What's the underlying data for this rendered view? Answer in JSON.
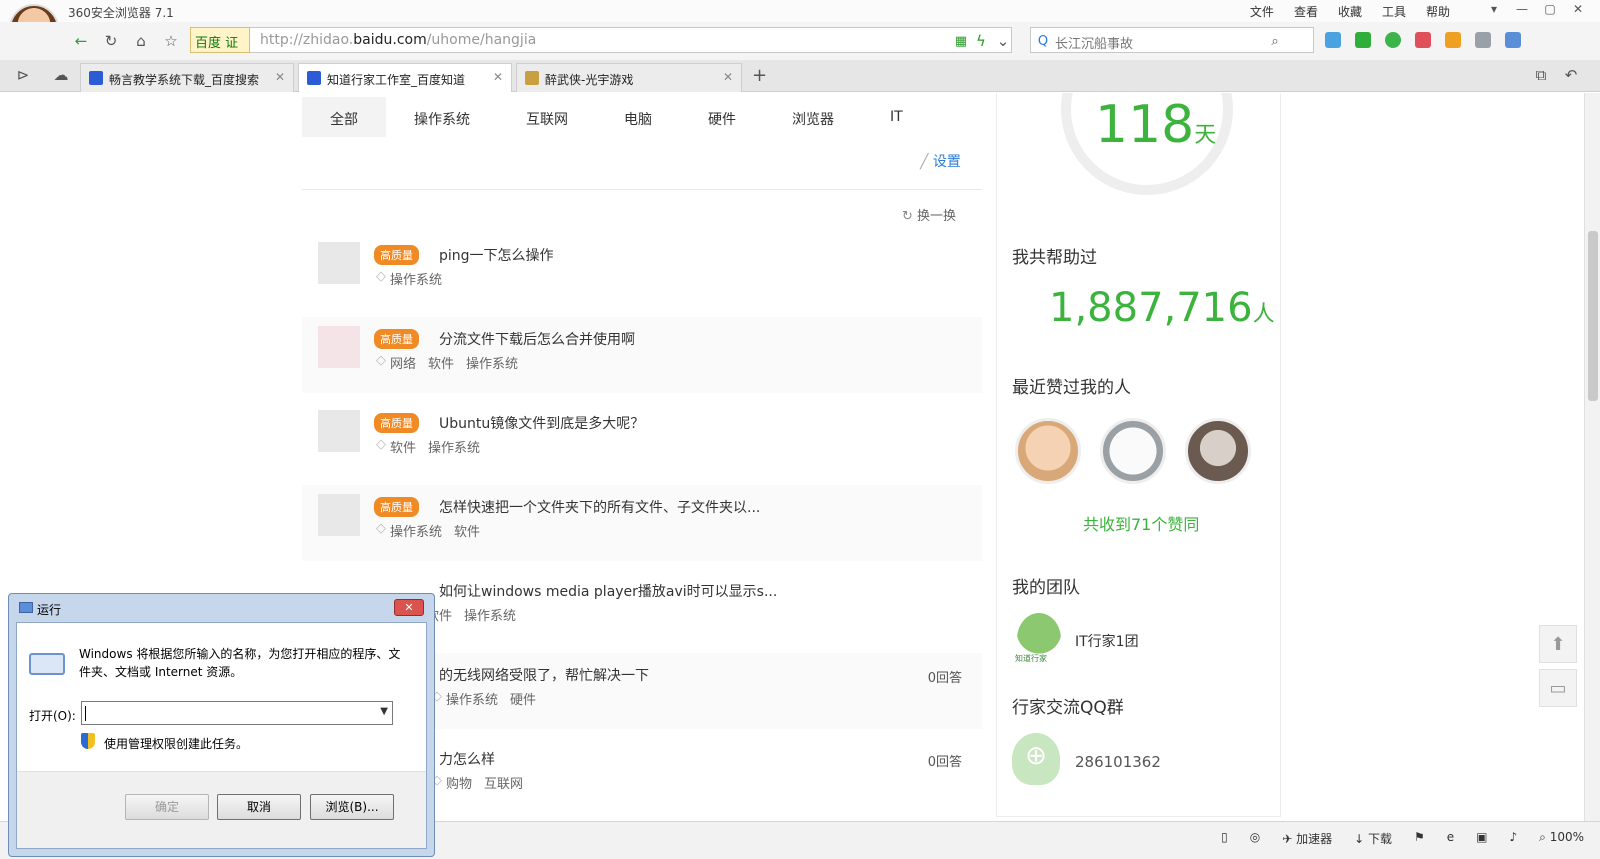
{
  "browser": {
    "app_title": "360安全浏览器 7.1",
    "menu": [
      "文件",
      "查看",
      "收藏",
      "工具",
      "帮助"
    ],
    "url_badge": "百度 证",
    "url_prefix": "http://zhidao.",
    "url_domain": "baidu.com",
    "url_path": "/uhome/hangjia",
    "search_placeholder": "长江沉船事故",
    "tabs": [
      {
        "label": "畅言教学系统下载_百度搜索"
      },
      {
        "label": "知道行家工作室_百度知道"
      },
      {
        "label": "醉武侠-光宇游戏"
      }
    ],
    "status": [
      "加速器",
      "下载",
      "100%"
    ]
  },
  "categories": [
    "全部",
    "操作系统",
    "互联网",
    "电脑",
    "硬件",
    "浏览器",
    "IT"
  ],
  "settings_label": "设置",
  "refresh_label": "换一换",
  "badge_label": "高质量",
  "questions": [
    {
      "title": "ping一下怎么操作",
      "tags": [
        "操作系统"
      ],
      "answers": ""
    },
    {
      "title": "分流文件下载后怎么合并使用啊",
      "tags": [
        "网络",
        "软件",
        "操作系统"
      ],
      "answers": ""
    },
    {
      "title": "Ubuntu镜像文件到底是多大呢？",
      "tags": [
        "软件",
        "操作系统"
      ],
      "answers": ""
    },
    {
      "title": "怎样快速把一个文件夹下的所有文件、子文件夹以...",
      "tags": [
        "操作系统",
        "软件"
      ],
      "answers": ""
    },
    {
      "title": "如何让windows media player播放avi时可以显示s...",
      "tags": [
        "软件",
        "操作系统"
      ],
      "answers": ""
    },
    {
      "title": "的无线网络受限了，帮忙解决一下",
      "tags": [
        "操作系统",
        "硬件"
      ],
      "answers": "0回答"
    },
    {
      "title": "力怎么样",
      "tags": [
        "购物",
        "互联网"
      ],
      "answers": "0回答"
    }
  ],
  "sidebar": {
    "days_value": "118",
    "days_unit": "天",
    "helped_heading": "我共帮助过",
    "helped_value": "1,887,716",
    "helped_unit": "人",
    "likers_heading": "最近赞过我的人",
    "likes_total": "共收到71个赞同",
    "team_heading": "我的团队",
    "team_logo_text": "知道行家",
    "team_name": "IT行家1团",
    "qq_heading": "行家交流QQ群",
    "qq_number": "286101362"
  },
  "run_dialog": {
    "title": "运行",
    "description": "Windows 将根据您所输入的名称，为您打开相应的程序、文件夹、文档或 Internet 资源。",
    "open_label": "打开(O):",
    "input_value": "",
    "admin_note": "使用管理权限创建此任务。",
    "ok_label": "确定",
    "cancel_label": "取消",
    "browse_label": "浏览(B)..."
  }
}
